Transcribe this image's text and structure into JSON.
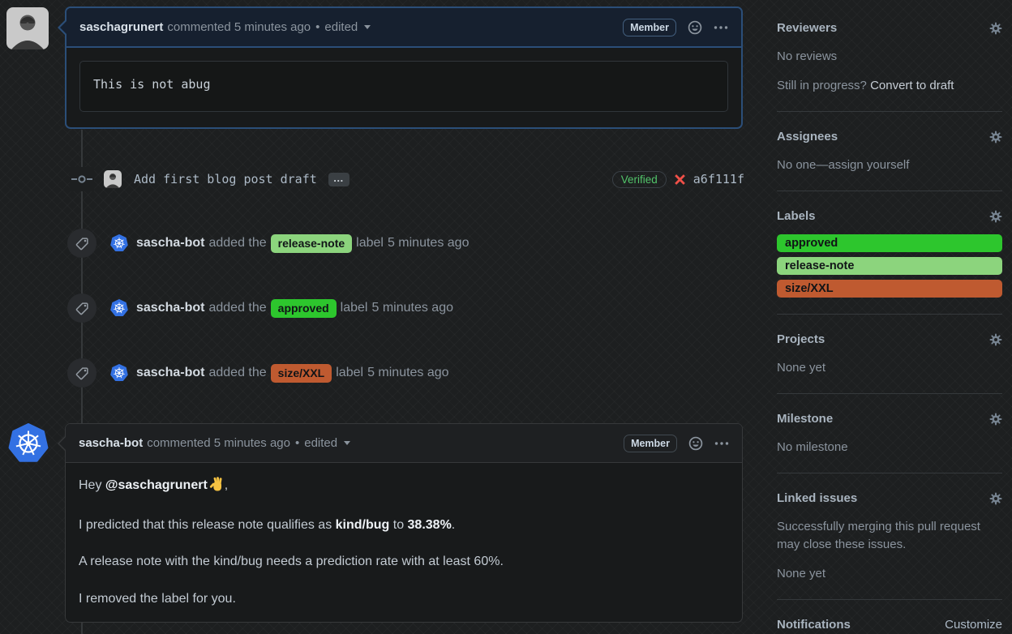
{
  "comments": [
    {
      "author": "saschagrunert",
      "meta": "commented 5 minutes ago",
      "separator": "•",
      "edited": "edited",
      "badge": "Member",
      "code": "This is not abug"
    },
    {
      "author": "sascha-bot",
      "meta": "commented 5 minutes ago",
      "separator": "•",
      "edited": "edited",
      "badge": "Member",
      "body": {
        "greeting_prefix": "Hey ",
        "mention": "@saschagrunert",
        "greeting_suffix": ",",
        "p1_a": "I predicted that this release note qualifies as ",
        "p1_bold_label": "kind/bug",
        "p1_b": " to ",
        "p1_bold_pct": "38.38%",
        "p1_end": ".",
        "p2": "A release note with the kind/bug needs a prediction rate with at least 60%.",
        "p3": "I removed the label for you."
      }
    }
  ],
  "commit": {
    "message": "Add first blog post draft",
    "expander": "…",
    "verified_badge": "Verified",
    "hash": "a6f111f"
  },
  "events": [
    {
      "actor": "sascha-bot",
      "action": "added the",
      "label": "release-note",
      "label_color": "#8cd47d",
      "suffix": "label",
      "time": "5 minutes ago"
    },
    {
      "actor": "sascha-bot",
      "action": "added the",
      "label": "approved",
      "label_color": "#2dc62d",
      "suffix": "label",
      "time": "5 minutes ago"
    },
    {
      "actor": "sascha-bot",
      "action": "added the",
      "label": "size/XXL",
      "label_color": "#bf5a30",
      "suffix": "label",
      "time": "5 minutes ago"
    }
  ],
  "sidebar": {
    "reviewers": {
      "title": "Reviewers",
      "empty": "No reviews",
      "hint_text": "Still in progress?",
      "hint_link": "Convert to draft"
    },
    "assignees": {
      "title": "Assignees",
      "empty": "No one—assign yourself"
    },
    "labels": {
      "title": "Labels",
      "items": [
        {
          "name": "approved",
          "color": "#2dc62d"
        },
        {
          "name": "release-note",
          "color": "#8cd47d"
        },
        {
          "name": "size/XXL",
          "color": "#bf5a30"
        }
      ]
    },
    "projects": {
      "title": "Projects",
      "empty": "None yet"
    },
    "milestone": {
      "title": "Milestone",
      "empty": "No milestone"
    },
    "linked_issues": {
      "title": "Linked issues",
      "description": "Successfully merging this pull request may close these issues.",
      "empty": "None yet"
    },
    "notifications": {
      "title": "Notifications",
      "action": "Customize"
    }
  },
  "colors": {
    "kubernetes_blue": "#3371e3",
    "verified_green": "#52c46a",
    "failure_red": "#f05048",
    "highlight_border": "#2b4e78"
  }
}
